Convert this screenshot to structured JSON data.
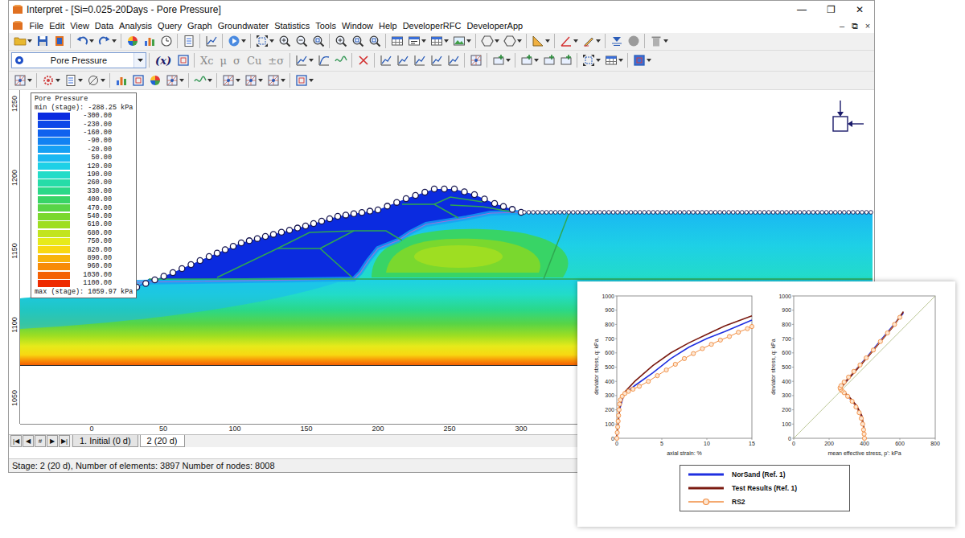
{
  "window": {
    "title": "Interpret - [Si=0.025-20Days - Pore Pressure]",
    "controls": [
      "—",
      "❐",
      "✕"
    ]
  },
  "menu": {
    "items": [
      "File",
      "Edit",
      "View",
      "Data",
      "Analysis",
      "Query",
      "Graph",
      "Groundwater",
      "Statistics",
      "Tools",
      "Window",
      "Help",
      "DeveloperRFC",
      "DeveloperApp"
    ],
    "child_controls": [
      "–",
      "⧉",
      "×"
    ]
  },
  "result_selector": {
    "value": "Pore Pressure"
  },
  "toolbar_text_buttons": [
    {
      "label": "(x)",
      "disabled": false
    },
    {
      "label": "Xc",
      "disabled": true
    },
    {
      "label": "μ",
      "disabled": true
    },
    {
      "label": "σ",
      "disabled": true
    },
    {
      "label": "Cu",
      "disabled": true
    },
    {
      "label": "±σ",
      "disabled": true
    }
  ],
  "legend": {
    "title": "Pore Pressure",
    "min": "min (stage): -288.25 kPa",
    "max": "max (stage): 1059.97 kPa",
    "items": [
      {
        "value": "-300.00",
        "color": "#0b2be0"
      },
      {
        "value": "-230.00",
        "color": "#0d48e8"
      },
      {
        "value": "-160.00",
        "color": "#0f62ee"
      },
      {
        "value": "-90.00",
        "color": "#1282f2"
      },
      {
        "value": "-20.00",
        "color": "#16a0f4"
      },
      {
        "value": "50.00",
        "color": "#1ab8f2"
      },
      {
        "value": "120.00",
        "color": "#1ed0e6"
      },
      {
        "value": "190.00",
        "color": "#22dcc8"
      },
      {
        "value": "260.00",
        "color": "#26dca8"
      },
      {
        "value": "330.00",
        "color": "#2ad888"
      },
      {
        "value": "400.00",
        "color": "#38d466"
      },
      {
        "value": "470.00",
        "color": "#58d446"
      },
      {
        "value": "540.00",
        "color": "#7ad82e"
      },
      {
        "value": "610.00",
        "color": "#9ede22"
      },
      {
        "value": "680.00",
        "color": "#c2e41e"
      },
      {
        "value": "750.00",
        "color": "#e6ea1a"
      },
      {
        "value": "820.00",
        "color": "#f8d812"
      },
      {
        "value": "890.00",
        "color": "#f8b40c"
      },
      {
        "value": "960.00",
        "color": "#f88c06"
      },
      {
        "value": "1030.00",
        "color": "#f46002"
      },
      {
        "value": "1100.00",
        "color": "#ee2a00"
      }
    ]
  },
  "axes": {
    "y_ticks": [
      "1250",
      "1200",
      "1150",
      "1100",
      "1050"
    ],
    "x_ticks": [
      "0",
      "50",
      "100",
      "150",
      "200",
      "250",
      "300"
    ]
  },
  "stage_nav": [
    "|◀",
    "◀",
    "#",
    "▶",
    "▶|"
  ],
  "stages": [
    {
      "label": "1. Initial (0 d)",
      "selected": false
    },
    {
      "label": "2 (20 d)",
      "selected": true
    }
  ],
  "status_bar": "Stage: 2 (20 d), Number of elements: 3897 Number of nodes: 8008",
  "inset": {
    "charts": [
      {
        "key": "stress_strain",
        "y_title": "deviator stress, q: kPa",
        "x_title": "axial strain: %",
        "y_ticks": [
          "0",
          "100",
          "200",
          "300",
          "400",
          "500",
          "600",
          "700",
          "800",
          "900",
          "1000"
        ],
        "x_ticks": [
          "0",
          "5",
          "10",
          "15"
        ],
        "reference_line": null
      },
      {
        "key": "stress_path",
        "y_title": "deviator stress, q: kPa",
        "x_title": "mean effective stress, p': kPa",
        "y_ticks": [
          "0",
          "100",
          "200",
          "300",
          "400",
          "500",
          "600",
          "700",
          "800",
          "900",
          "1000"
        ],
        "x_ticks": [
          "0",
          "200",
          "400",
          "600",
          "800"
        ],
        "reference_line": [
          [
            0,
            0
          ],
          [
            800,
            1000
          ]
        ]
      }
    ],
    "series": [
      {
        "label": "NorSand (Ref. 1)",
        "color": "#1f2fe0",
        "kind": "line",
        "stress_strain": [
          [
            0,
            0
          ],
          [
            0.3,
            200
          ],
          [
            0.8,
            310
          ],
          [
            2,
            370
          ],
          [
            4,
            460
          ],
          [
            6,
            560
          ],
          [
            8,
            640
          ],
          [
            10,
            700
          ],
          [
            12,
            750
          ],
          [
            15,
            830
          ]
        ],
        "stress_path": [
          [
            400,
            0
          ],
          [
            395,
            80
          ],
          [
            380,
            160
          ],
          [
            350,
            230
          ],
          [
            310,
            290
          ],
          [
            280,
            325
          ],
          [
            265,
            345
          ],
          [
            270,
            365
          ],
          [
            300,
            410
          ],
          [
            350,
            480
          ],
          [
            420,
            580
          ],
          [
            500,
            700
          ],
          [
            560,
            790
          ],
          [
            620,
            880
          ]
        ]
      },
      {
        "label": "Test Results (Ref. 1)",
        "color": "#7a1a10",
        "kind": "line",
        "stress_strain": [
          [
            0,
            0
          ],
          [
            0.3,
            220
          ],
          [
            0.8,
            320
          ],
          [
            2,
            400
          ],
          [
            4,
            510
          ],
          [
            6,
            600
          ],
          [
            8,
            670
          ],
          [
            10,
            730
          ],
          [
            12,
            790
          ],
          [
            15,
            860
          ]
        ],
        "stress_path": [
          [
            400,
            0
          ],
          [
            396,
            80
          ],
          [
            385,
            160
          ],
          [
            355,
            230
          ],
          [
            315,
            290
          ],
          [
            285,
            325
          ],
          [
            270,
            345
          ],
          [
            275,
            365
          ],
          [
            305,
            410
          ],
          [
            355,
            480
          ],
          [
            425,
            580
          ],
          [
            505,
            700
          ],
          [
            565,
            790
          ],
          [
            620,
            890
          ]
        ]
      },
      {
        "label": "RS2",
        "color": "#f08c40",
        "kind": "markers",
        "stress_strain": [
          [
            0,
            0
          ],
          [
            0.05,
            40
          ],
          [
            0.1,
            80
          ],
          [
            0.15,
            120
          ],
          [
            0.2,
            160
          ],
          [
            0.25,
            200
          ],
          [
            0.3,
            240
          ],
          [
            0.4,
            270
          ],
          [
            0.6,
            295
          ],
          [
            0.9,
            315
          ],
          [
            1.3,
            330
          ],
          [
            1.8,
            345
          ],
          [
            2.5,
            365
          ],
          [
            3.5,
            400
          ],
          [
            4.5,
            440
          ],
          [
            5.5,
            480
          ],
          [
            6.5,
            520
          ],
          [
            7.5,
            560
          ],
          [
            8.5,
            595
          ],
          [
            9.5,
            630
          ],
          [
            10.5,
            660
          ],
          [
            11.5,
            690
          ],
          [
            12.5,
            715
          ],
          [
            13.5,
            745
          ],
          [
            14.5,
            770
          ],
          [
            15,
            785
          ]
        ],
        "stress_path": [
          [
            400,
            0
          ],
          [
            398,
            30
          ],
          [
            395,
            60
          ],
          [
            390,
            100
          ],
          [
            382,
            140
          ],
          [
            370,
            180
          ],
          [
            352,
            220
          ],
          [
            330,
            260
          ],
          [
            305,
            295
          ],
          [
            285,
            320
          ],
          [
            272,
            335
          ],
          [
            265,
            345
          ],
          [
            262,
            355
          ],
          [
            268,
            370
          ],
          [
            285,
            395
          ],
          [
            310,
            430
          ],
          [
            340,
            470
          ],
          [
            375,
            515
          ],
          [
            410,
            565
          ],
          [
            450,
            620
          ],
          [
            490,
            680
          ],
          [
            530,
            740
          ],
          [
            570,
            800
          ],
          [
            600,
            850
          ]
        ]
      }
    ]
  }
}
